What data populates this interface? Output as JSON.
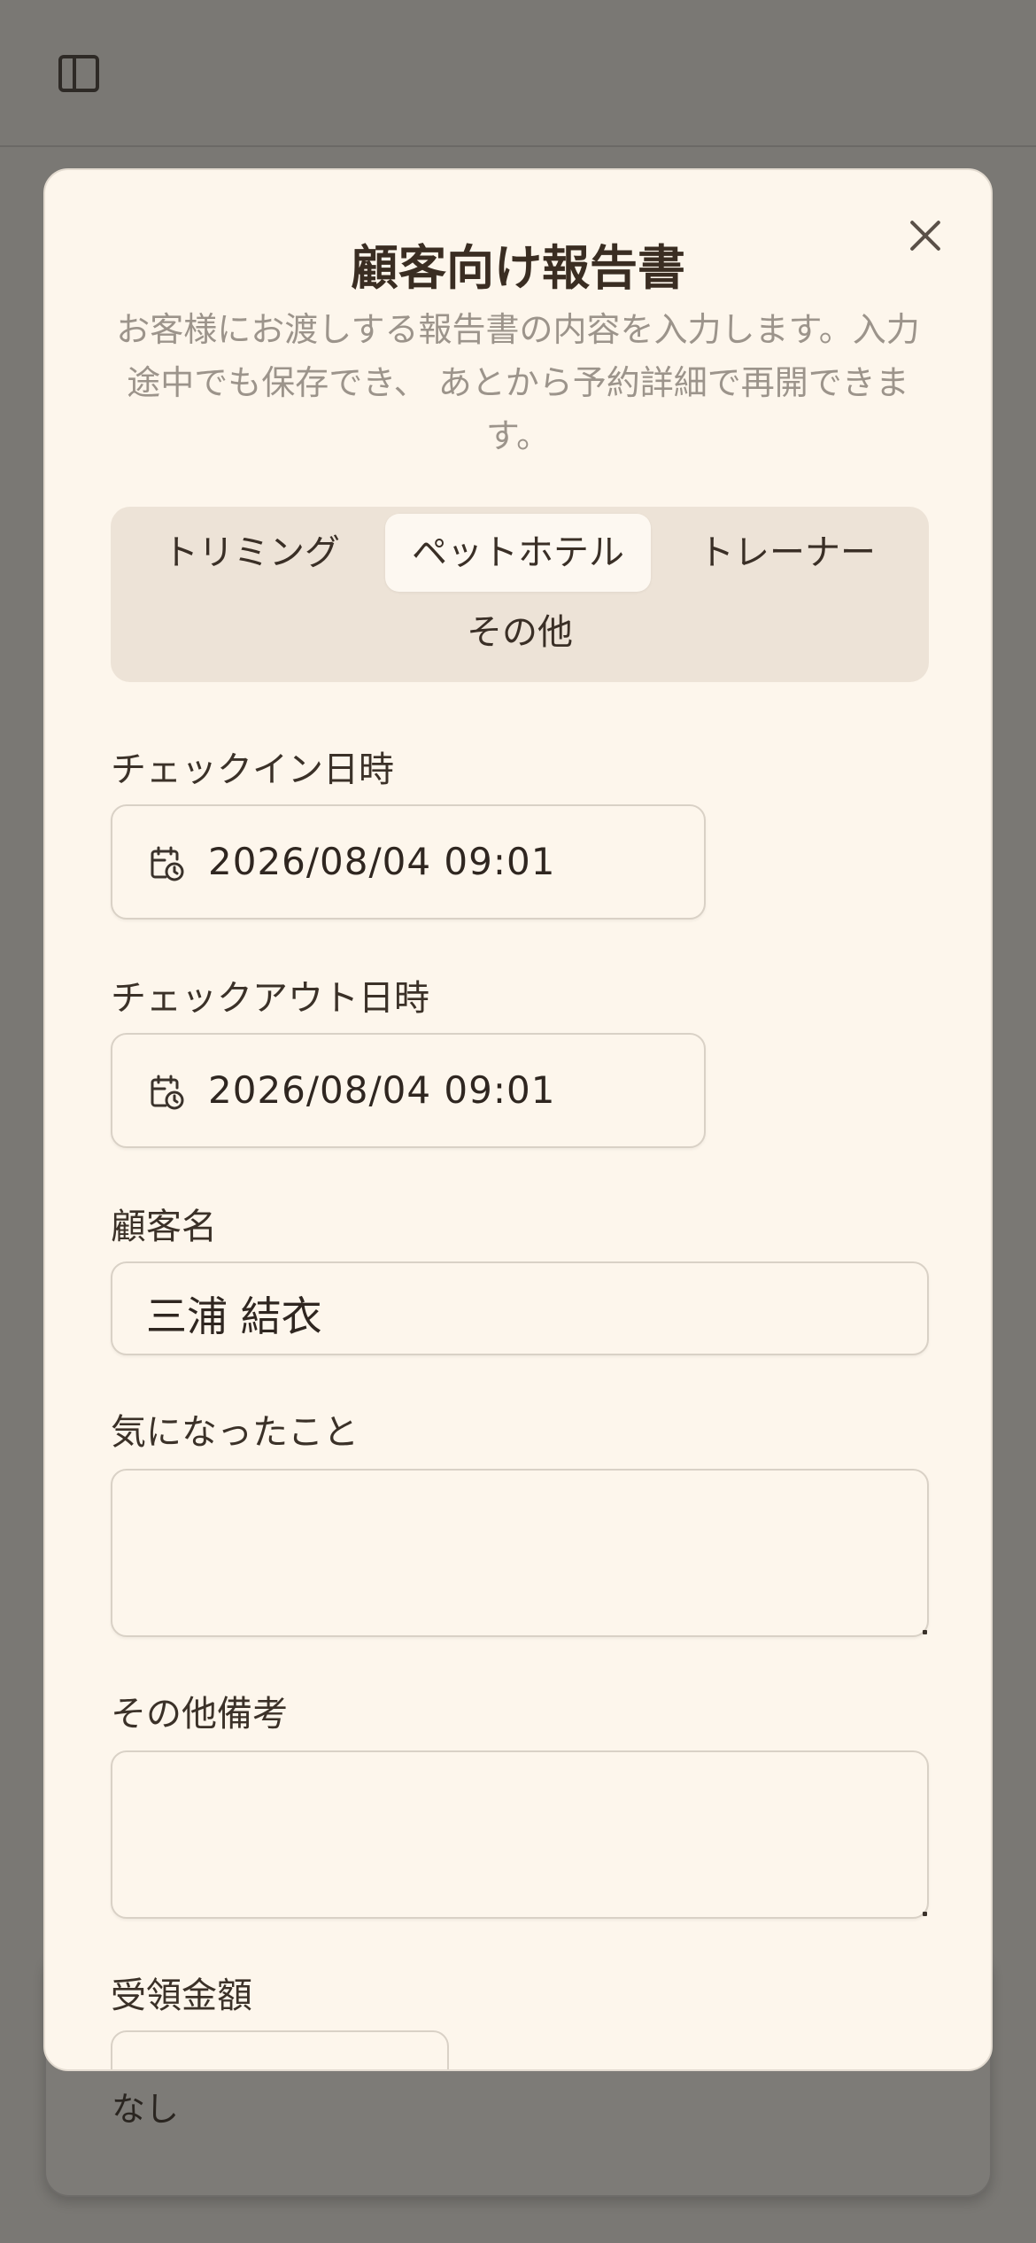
{
  "background": {
    "sidebar_toggle_icon": "sidebar-panel-icon",
    "card_text": "なし"
  },
  "dialog": {
    "title": "顧客向け報告書",
    "description": "お客様にお渡しする報告書の内容を入力します。入力途中でも保存でき、 あとから予約詳細で再開できます。",
    "close_icon": "close-icon",
    "tabs": [
      {
        "label": "トリミング",
        "active": false
      },
      {
        "label": "ペットホテル",
        "active": true
      },
      {
        "label": "トレーナー",
        "active": false
      },
      {
        "label": "その他",
        "active": false
      }
    ],
    "form": {
      "checkin_label": "チェックイン日時",
      "checkin_value": "2026/08/04 09:01",
      "checkout_label": "チェックアウト日時",
      "checkout_value": "2026/08/04 09:01",
      "customer_label": "顧客名",
      "customer_value": "三浦 結衣",
      "concerns_label": "気になったこと",
      "concerns_value": "",
      "notes_label": "その他備考",
      "notes_value": "",
      "amount_label": "受領金額",
      "amount_value": ""
    }
  }
}
